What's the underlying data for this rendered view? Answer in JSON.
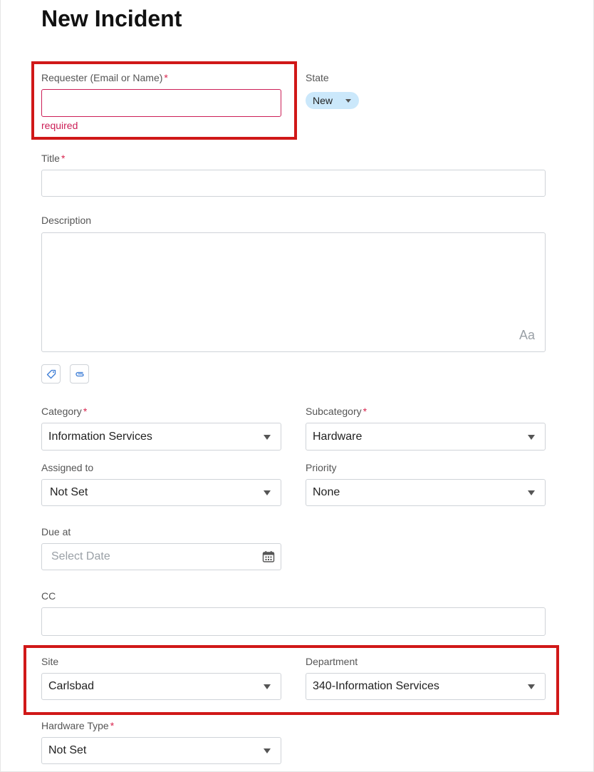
{
  "page": {
    "title": "New Incident"
  },
  "requester": {
    "label": "Requester (Email or Name)",
    "required_mark": "*",
    "value": "",
    "error": "required"
  },
  "state": {
    "label": "State",
    "value": "New"
  },
  "title_field": {
    "label": "Title",
    "required_mark": "*",
    "value": ""
  },
  "description": {
    "label": "Description",
    "value": "",
    "format_icon_text": "Aa"
  },
  "toolbar": {
    "icons": [
      "tag-icon",
      "paperclip-icon"
    ]
  },
  "category": {
    "label": "Category",
    "required_mark": "*",
    "value": "Information Services"
  },
  "subcategory": {
    "label": "Subcategory",
    "required_mark": "*",
    "value": "Hardware"
  },
  "assigned_to": {
    "label": "Assigned to",
    "value": "Not Set"
  },
  "priority": {
    "label": "Priority",
    "value": "None"
  },
  "due_at": {
    "label": "Due at",
    "placeholder": "Select Date",
    "icon": "calendar-icon"
  },
  "cc": {
    "label": "CC",
    "value": ""
  },
  "site": {
    "label": "Site",
    "value": "Carlsbad"
  },
  "department": {
    "label": "Department",
    "value": "340-Information Services"
  },
  "hardware_type": {
    "label": "Hardware Type",
    "required_mark": "*",
    "value": "Not Set"
  },
  "colors": {
    "required": "#d9244e",
    "error": "#cc1f57",
    "highlight": "#d01818",
    "state_pill": "#cbe8fb"
  }
}
